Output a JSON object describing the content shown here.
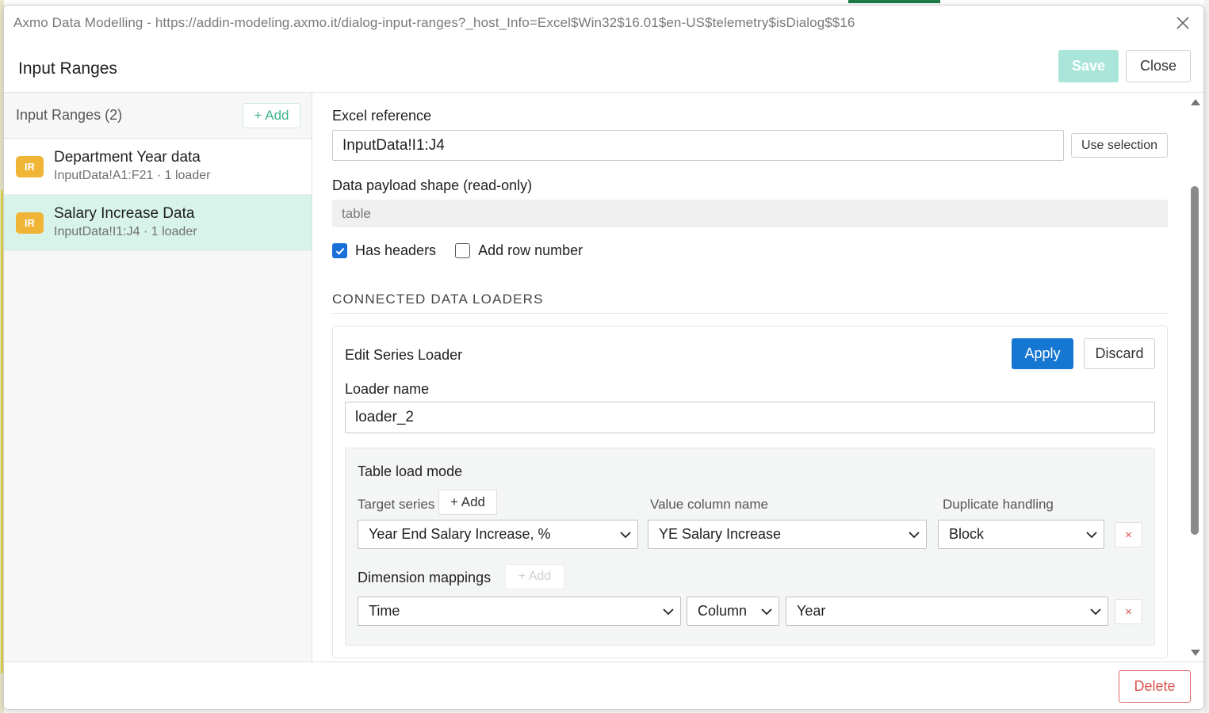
{
  "window": {
    "title": "Axmo Data Modelling - https://addin-modeling.axmo.it/dialog-input-ranges?_host_Info=Excel$Win32$16.01$en-US$telemetry$isDialog$$16"
  },
  "header": {
    "title": "Input Ranges",
    "save_label": "Save",
    "close_label": "Close"
  },
  "sidebar": {
    "title": "Input Ranges (2)",
    "add_label": "+ Add",
    "items": [
      {
        "badge": "IR",
        "name": "Department Year data",
        "sub": "InputData!A1:F21 · 1 loader",
        "selected": false
      },
      {
        "badge": "IR",
        "name": "Salary Increase Data",
        "sub": "InputData!I1:J4 · 1 loader",
        "selected": true
      }
    ]
  },
  "main": {
    "excel_ref_label": "Excel reference",
    "excel_ref_value": "InputData!I1:J4",
    "use_selection_label": "Use selection",
    "shape_label": "Data payload shape (read-only)",
    "shape_value": "table",
    "has_headers_label": "Has headers",
    "has_headers_checked": true,
    "add_row_number_label": "Add row number",
    "add_row_number_checked": false,
    "section_title": "CONNECTED DATA LOADERS",
    "loader": {
      "title": "Edit Series Loader",
      "apply_label": "Apply",
      "discard_label": "Discard",
      "name_label": "Loader name",
      "name_value": "loader_2",
      "mode_title": "Table load mode",
      "target_series_label": "Target series",
      "target_add_label": "+ Add",
      "value_column_label": "Value column name",
      "duplicate_label": "Duplicate handling",
      "target_series_value": "Year End Salary Increase, %",
      "value_column_value": "YE Salary Increase",
      "duplicate_value": "Block",
      "remove_symbol": "×",
      "dimension_label": "Dimension mappings",
      "dimension_add_label": "+ Add",
      "dimension_value": "Time",
      "dimension_source_value": "Column",
      "dimension_column_value": "Year"
    }
  },
  "footer": {
    "delete_label": "Delete"
  },
  "colors": {
    "accent_green": "#3db489",
    "save_disabled": "#a9e6d9",
    "apply_blue": "#1677d2",
    "badge_orange": "#f0b536",
    "selected_row": "#d8f3ea",
    "delete_red": "#d9534f"
  },
  "icons": {
    "close": "close-icon",
    "chevron": "chevron-down-icon",
    "check": "check-icon"
  }
}
